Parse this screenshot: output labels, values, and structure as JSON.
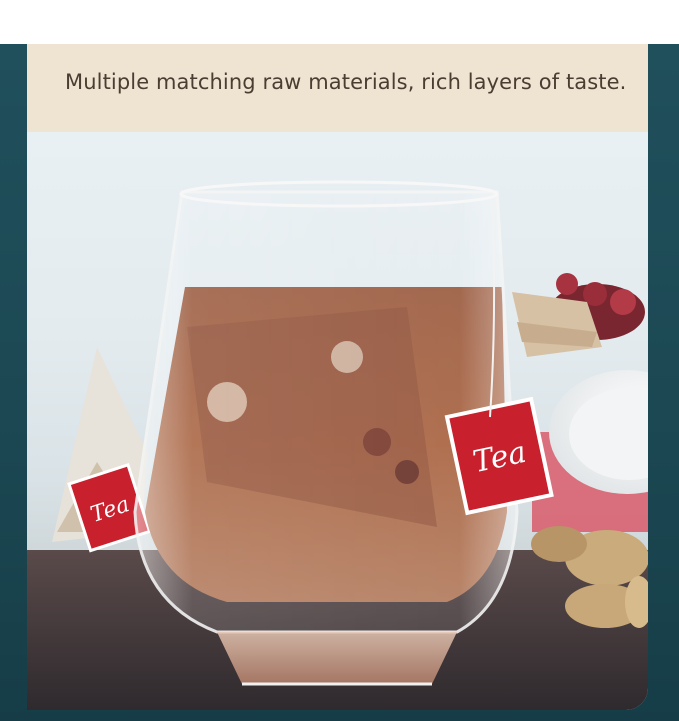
{
  "caption": {
    "text": "Multiple matching raw materials, rich layers of taste."
  },
  "photo": {
    "tag_label_right": "Tea",
    "tag_label_left": "Tea"
  },
  "colors": {
    "frame": "#1f4a55",
    "caption_bg": "#efe4d2",
    "caption_text": "#4a3e33",
    "tag_red": "#c8202c"
  }
}
